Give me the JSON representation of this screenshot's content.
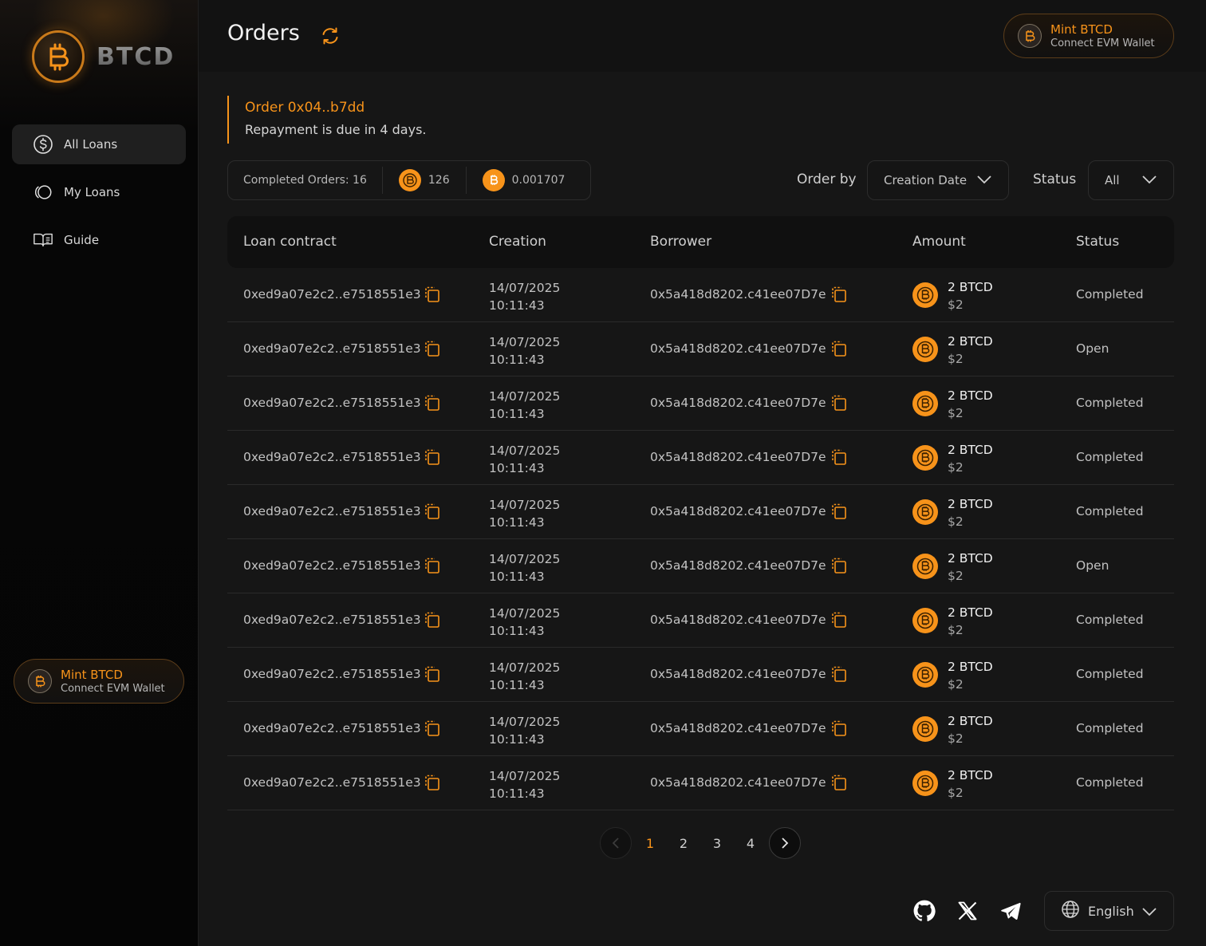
{
  "brand": {
    "name": "BTCD"
  },
  "nav": {
    "items": [
      {
        "label": "All Loans",
        "icon": "dollar-circle-icon",
        "active": true
      },
      {
        "label": "My Loans",
        "icon": "loans-icon",
        "active": false
      },
      {
        "label": "Guide",
        "icon": "book-icon",
        "active": false
      }
    ]
  },
  "mint": {
    "title": "Mint BTCD",
    "subtitle": "Connect EVM Wallet"
  },
  "header": {
    "title": "Orders"
  },
  "notice": {
    "title": "Order 0x04..b7dd",
    "text": "Repayment is due in 4 days."
  },
  "stats": {
    "completed": "Completed Orders: 16",
    "btcd_total": "126",
    "btc_total": "0.001707"
  },
  "filters": {
    "order_by_label": "Order by",
    "order_by_value": "Creation Date",
    "status_label": "Status",
    "status_value": "All"
  },
  "table": {
    "columns": [
      "Loan contract",
      "Creation",
      "Borrower",
      "Amount",
      "Status"
    ],
    "rows": [
      {
        "contract": "0xed9a07e2c2..e7518551e3",
        "date": "14/07/2025",
        "time": "10:11:43",
        "borrower": "0x5a418d8202.c41ee07D7e",
        "amount": "2 BTCD",
        "usd": "$2",
        "status": "Completed"
      },
      {
        "contract": "0xed9a07e2c2..e7518551e3",
        "date": "14/07/2025",
        "time": "10:11:43",
        "borrower": "0x5a418d8202.c41ee07D7e",
        "amount": "2 BTCD",
        "usd": "$2",
        "status": "Open"
      },
      {
        "contract": "0xed9a07e2c2..e7518551e3",
        "date": "14/07/2025",
        "time": "10:11:43",
        "borrower": "0x5a418d8202.c41ee07D7e",
        "amount": "2 BTCD",
        "usd": "$2",
        "status": "Completed"
      },
      {
        "contract": "0xed9a07e2c2..e7518551e3",
        "date": "14/07/2025",
        "time": "10:11:43",
        "borrower": "0x5a418d8202.c41ee07D7e",
        "amount": "2 BTCD",
        "usd": "$2",
        "status": "Completed"
      },
      {
        "contract": "0xed9a07e2c2..e7518551e3",
        "date": "14/07/2025",
        "time": "10:11:43",
        "borrower": "0x5a418d8202.c41ee07D7e",
        "amount": "2 BTCD",
        "usd": "$2",
        "status": "Completed"
      },
      {
        "contract": "0xed9a07e2c2..e7518551e3",
        "date": "14/07/2025",
        "time": "10:11:43",
        "borrower": "0x5a418d8202.c41ee07D7e",
        "amount": "2 BTCD",
        "usd": "$2",
        "status": "Open"
      },
      {
        "contract": "0xed9a07e2c2..e7518551e3",
        "date": "14/07/2025",
        "time": "10:11:43",
        "borrower": "0x5a418d8202.c41ee07D7e",
        "amount": "2 BTCD",
        "usd": "$2",
        "status": "Completed"
      },
      {
        "contract": "0xed9a07e2c2..e7518551e3",
        "date": "14/07/2025",
        "time": "10:11:43",
        "borrower": "0x5a418d8202.c41ee07D7e",
        "amount": "2 BTCD",
        "usd": "$2",
        "status": "Completed"
      },
      {
        "contract": "0xed9a07e2c2..e7518551e3",
        "date": "14/07/2025",
        "time": "10:11:43",
        "borrower": "0x5a418d8202.c41ee07D7e",
        "amount": "2 BTCD",
        "usd": "$2",
        "status": "Completed"
      },
      {
        "contract": "0xed9a07e2c2..e7518551e3",
        "date": "14/07/2025",
        "time": "10:11:43",
        "borrower": "0x5a418d8202.c41ee07D7e",
        "amount": "2 BTCD",
        "usd": "$2",
        "status": "Completed"
      }
    ]
  },
  "pagination": {
    "pages": [
      "1",
      "2",
      "3",
      "4"
    ],
    "current": "1"
  },
  "footer": {
    "social": [
      "github-icon",
      "x-icon",
      "telegram-icon"
    ],
    "language": "English"
  },
  "colors": {
    "accent": "#f7931a",
    "background": "#161616",
    "sidebar": "#050505"
  }
}
